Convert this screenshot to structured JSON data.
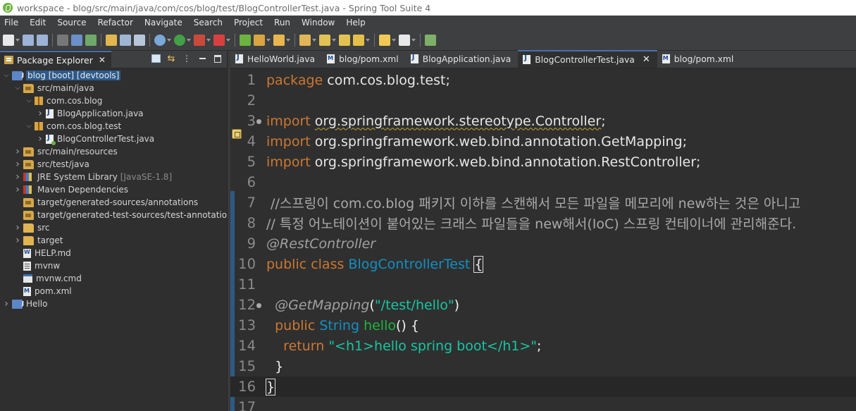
{
  "window": {
    "title": "workspace - blog/src/main/java/com/cos/blog/test/BlogControllerTest.java - Spring Tool Suite 4"
  },
  "menu": [
    "File",
    "Edit",
    "Source",
    "Refactor",
    "Navigate",
    "Search",
    "Project",
    "Run",
    "Window",
    "Help"
  ],
  "toolbar_icons": [
    "new-icon",
    "save-icon",
    "save-all-icon",
    "terminal-icon",
    "skip-breakpoints-icon",
    "toggle-ant-editor-icon",
    "mark-occurrences-icon",
    "show-whitespace-icon",
    "block-selection-icon",
    "debug-icon",
    "run-icon",
    "run-last-tool-icon",
    "stop-icon",
    "spring-boot-dashboard-icon",
    "new-java-class-icon",
    "open-type-icon",
    "search-icon",
    "next-annotation-icon",
    "previous-annotation-icon",
    "last-edit-location-icon",
    "back-icon",
    "forward-icon",
    "open-perspective-icon"
  ],
  "explorer": {
    "tab_label": "Package Explorer",
    "close_glyph": "✕",
    "tree": [
      {
        "label": "blog [boot] [devtools]",
        "decor": "",
        "icon": "project",
        "arrow": "down",
        "selected": true
      },
      {
        "label": "src/main/java",
        "decor": "",
        "icon": "srcfolder",
        "arrow": "down"
      },
      {
        "label": "com.cos.blog",
        "decor": "",
        "icon": "package",
        "arrow": "down"
      },
      {
        "label": "BlogApplication.java",
        "decor": "",
        "icon": "javafile",
        "arrow": "right"
      },
      {
        "label": "com.cos.blog.test",
        "decor": "",
        "icon": "package",
        "arrow": "down"
      },
      {
        "label": "BlogControllerTest.java",
        "decor": "",
        "icon": "javatest",
        "arrow": "right"
      },
      {
        "label": "src/main/resources",
        "decor": "",
        "icon": "srcfolder",
        "arrow": "right"
      },
      {
        "label": "src/test/java",
        "decor": "",
        "icon": "srcfolder",
        "arrow": "right"
      },
      {
        "label": "JRE System Library",
        "decor": "[JavaSE-1.8]",
        "icon": "library",
        "arrow": "right"
      },
      {
        "label": "Maven Dependencies",
        "decor": "",
        "icon": "library",
        "arrow": "right"
      },
      {
        "label": "target/generated-sources/annotations",
        "decor": "",
        "icon": "srcfolder",
        "arrow": "none"
      },
      {
        "label": "target/generated-test-sources/test-annotations",
        "decor": "",
        "icon": "srcfolder",
        "arrow": "none"
      },
      {
        "label": "src",
        "decor": "",
        "icon": "folder",
        "arrow": "right"
      },
      {
        "label": "target",
        "decor": "",
        "icon": "folder",
        "arrow": "right"
      },
      {
        "label": "HELP.md",
        "decor": "",
        "icon": "mdfile",
        "arrow": "none"
      },
      {
        "label": "mvnw",
        "decor": "",
        "icon": "textfile",
        "arrow": "none"
      },
      {
        "label": "mvnw.cmd",
        "decor": "",
        "icon": "cmdfile",
        "arrow": "none"
      },
      {
        "label": "pom.xml",
        "decor": "",
        "icon": "xmlfile",
        "arrow": "none"
      },
      {
        "label": "Hello",
        "decor": "",
        "icon": "project",
        "arrow": "right"
      }
    ]
  },
  "editor": {
    "tabs": [
      {
        "label": "HelloWorld.java",
        "type": "java",
        "active": false
      },
      {
        "label": "blog/pom.xml",
        "type": "xml",
        "active": false
      },
      {
        "label": "BlogApplication.java",
        "type": "java",
        "active": false
      },
      {
        "label": "BlogControllerTest.java",
        "type": "java",
        "active": true
      },
      {
        "label": "blog/pom.xml",
        "type": "xml",
        "active": false
      }
    ],
    "close_glyph": "✕",
    "lines": [
      {
        "n": "1",
        "fold": false,
        "tokens": [
          [
            "kw",
            "package"
          ],
          [
            "pk",
            " com.cos.blog.test;"
          ]
        ]
      },
      {
        "n": "2",
        "fold": false,
        "tokens": []
      },
      {
        "n": "3",
        "fold": true,
        "tokens": [
          [
            "kw",
            "import"
          ],
          [
            "pk",
            " "
          ],
          [
            "pk uline",
            "org.springframework.stereotype.Controller"
          ],
          [
            "pk",
            ";"
          ]
        ]
      },
      {
        "n": "4",
        "fold": false,
        "tokens": [
          [
            "kw",
            "import"
          ],
          [
            "pk",
            " org.springframework.web.bind.annotation.GetMapping;"
          ]
        ]
      },
      {
        "n": "5",
        "fold": false,
        "tokens": [
          [
            "kw",
            "import"
          ],
          [
            "pk",
            " org.springframework.web.bind.annotation.RestController;"
          ]
        ]
      },
      {
        "n": "6",
        "fold": false,
        "tokens": []
      },
      {
        "n": "7",
        "fold": false,
        "tokens": [
          [
            "cm",
            " //스프링이 com.co.blog 패키지 이하를 스캔해서 모든 파일을 메모리에 new하는 것은 아니고"
          ]
        ]
      },
      {
        "n": "8",
        "fold": false,
        "tokens": [
          [
            "cm",
            "// 특정 어노테이션이 붙어있는 크래스 파일들을 new해서(IoC) 스프링 컨테이너에 관리해준다."
          ]
        ]
      },
      {
        "n": "9",
        "fold": false,
        "tokens": [
          [
            "an",
            "@RestController"
          ]
        ]
      },
      {
        "n": "10",
        "fold": false,
        "tokens": [
          [
            "kw",
            "public class "
          ],
          [
            "cls",
            "BlogControllerTest"
          ],
          [
            "pl",
            " "
          ],
          [
            "pl brace-box",
            "{"
          ]
        ]
      },
      {
        "n": "11",
        "fold": false,
        "tokens": []
      },
      {
        "n": "12",
        "fold": true,
        "tokens": [
          [
            "pl",
            "  "
          ],
          [
            "an",
            "@GetMapping"
          ],
          [
            "pl",
            "("
          ],
          [
            "str",
            "\"/test/hello\""
          ],
          [
            "pl",
            ")"
          ]
        ]
      },
      {
        "n": "13",
        "fold": false,
        "tokens": [
          [
            "pl",
            "  "
          ],
          [
            "kw",
            "public "
          ],
          [
            "cls",
            "String "
          ],
          [
            "mth",
            "hello"
          ],
          [
            "pl",
            "() {"
          ]
        ]
      },
      {
        "n": "14",
        "fold": false,
        "tokens": [
          [
            "pl",
            "    "
          ],
          [
            "kw",
            "return "
          ],
          [
            "str",
            "\"<h1>hello spring boot</h1>\""
          ],
          [
            "pl",
            ";"
          ]
        ]
      },
      {
        "n": "15",
        "fold": false,
        "tokens": [
          [
            "pl",
            "  }"
          ]
        ]
      },
      {
        "n": "16",
        "fold": false,
        "tokens": [
          [
            "pl brace-box",
            "}"
          ]
        ]
      },
      {
        "n": "17",
        "fold": false,
        "tokens": []
      }
    ]
  }
}
